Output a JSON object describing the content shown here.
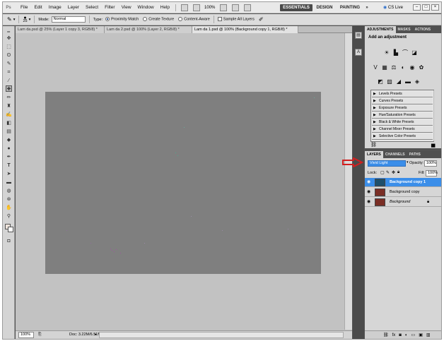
{
  "menubar": {
    "logo": "Ps",
    "items": [
      "File",
      "Edit",
      "Image",
      "Layer",
      "Select",
      "Filter",
      "View",
      "Window",
      "Help"
    ],
    "zoom": "100%",
    "workspaces": [
      "ESSENTIALS",
      "DESIGN",
      "PAINTING"
    ],
    "more": "»",
    "cs_live": "CS Live",
    "window_buttons": [
      "–",
      "□",
      "×"
    ]
  },
  "options": {
    "brush_size": "25",
    "mode_label": "Mode:",
    "mode_value": "Normal",
    "type_label": "Type:",
    "type_options": [
      "Proximity Match",
      "Create Texture",
      "Content-Aware"
    ],
    "selected_type": "Proximity Match",
    "sample_all_layers": "Sample All Layers"
  },
  "document": {
    "tabs": [
      "Lam da.psd @ 25% (Layer 1 copy 3, RGB/8) *",
      "Lam da 2.psd @ 100% (Layer 2, RGB/8) *",
      "Lam da 1.psd @ 100% (Background copy 1, RGB/8) *"
    ],
    "active_tab": 2,
    "zoom": "100%",
    "doc_size": "Doc: 3.22M/6.51M"
  },
  "colors": {
    "canvas": "#7f7f7f",
    "selection": "#3b8ee9",
    "arrow": "#d21f1f",
    "workspace_active": "#4a4a4a"
  },
  "adjustments": {
    "tabs": [
      "ADJUSTMENTS",
      "MASKS",
      "ACTIONS"
    ],
    "title": "Add an adjustment",
    "icons": [
      "brightness-contrast-icon",
      "levels-icon",
      "curves-icon",
      "exposure-icon",
      "vibrance-icon",
      "hue-saturation-icon",
      "color-balance-icon",
      "black-white-icon",
      "photo-filter-icon",
      "channel-mixer-icon",
      "invert-icon",
      "posterize-icon",
      "threshold-icon",
      "gradient-map-icon",
      "selective-color-icon"
    ],
    "presets": [
      "Levels Presets",
      "Curves Presets",
      "Exposure Presets",
      "Hue/Saturation Presets",
      "Black & White Presets",
      "Channel Mixer Presets",
      "Selective Color Presets"
    ]
  },
  "layers": {
    "tabs": [
      "LAYERS",
      "CHANNELS",
      "PATHS"
    ],
    "blend_mode": "Vivid Light",
    "opacity_label": "Opacity:",
    "opacity": "100%",
    "lock_label": "Lock:",
    "fill_label": "Fill:",
    "fill": "100%",
    "items": [
      {
        "name": "Background copy 1",
        "selected": true
      },
      {
        "name": "Background copy",
        "selected": false
      },
      {
        "name": "Background",
        "selected": false,
        "locked": true
      }
    ],
    "footer_icons": [
      "link-icon",
      "fx-icon",
      "mask-icon",
      "adjustment-icon",
      "folder-icon",
      "new-layer-icon",
      "trash-icon"
    ]
  }
}
